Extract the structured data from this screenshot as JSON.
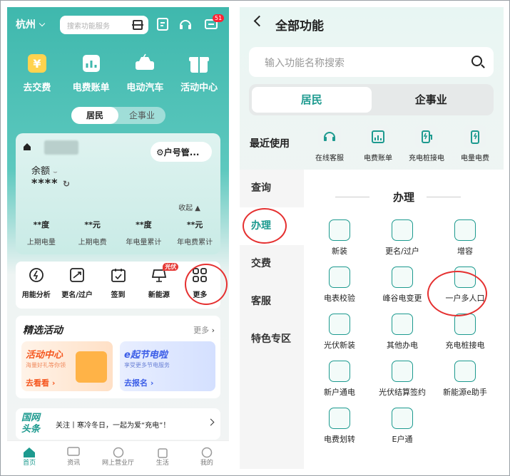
{
  "left": {
    "city": "杭州",
    "search_placeholder": "搜索功能服务",
    "notify_badge": "51",
    "quick": [
      "去交费",
      "电费账单",
      "电动汽车",
      "活动中心"
    ],
    "segment": [
      "居民",
      "企事业"
    ],
    "account": {
      "huhao_btn": "户号管...",
      "balance_label": "余额",
      "balance_value": "****",
      "shouqi": "收起",
      "stats": [
        {
          "value": "**度",
          "label": "上期电量"
        },
        {
          "value": "**元",
          "label": "上期电费"
        },
        {
          "value": "**度",
          "label": "年电量累计"
        },
        {
          "value": "**元",
          "label": "年电费累计"
        }
      ]
    },
    "services": [
      "用能分析",
      "更名/过户",
      "签到",
      "新能源",
      "更多"
    ],
    "pv_tag": "光伏",
    "activities": {
      "title": "精选活动",
      "more": "更多",
      "card1": {
        "title": "活动中心",
        "sub": "海量好礼等你领",
        "btn": "去看看"
      },
      "card2": {
        "title": "e起节电啦",
        "sub": "享受更多节电服务",
        "btn": "去报名"
      }
    },
    "news": {
      "logo1": "国网",
      "logo2": "头条",
      "text": "关注丨寒冷冬日，一起为爱“充电”！"
    },
    "tabbar": [
      "首页",
      "资讯",
      "网上营业厅",
      "生活",
      "我的"
    ]
  },
  "right": {
    "title": "全部功能",
    "search_placeholder": "输入功能名称搜索",
    "segment": [
      "居民",
      "企事业"
    ],
    "recent_label": "最近使用",
    "recent": [
      "在线客服",
      "电费账单",
      "充电桩接电",
      "电量电费"
    ],
    "categories": [
      "查询",
      "办理",
      "交费",
      "客服",
      "特色专区"
    ],
    "section_title": "办理",
    "items": [
      "新装",
      "更名/过户",
      "增容",
      "电表校验",
      "峰谷电变更",
      "一户多人口",
      "光伏新装",
      "其他办电",
      "充电桩接电",
      "新户通电",
      "光伏结算签约",
      "新能源e助手",
      "电费划转",
      "E户通"
    ]
  },
  "colors": {
    "brand": "#1d9a8f",
    "highlight_circle": "#e53030"
  }
}
